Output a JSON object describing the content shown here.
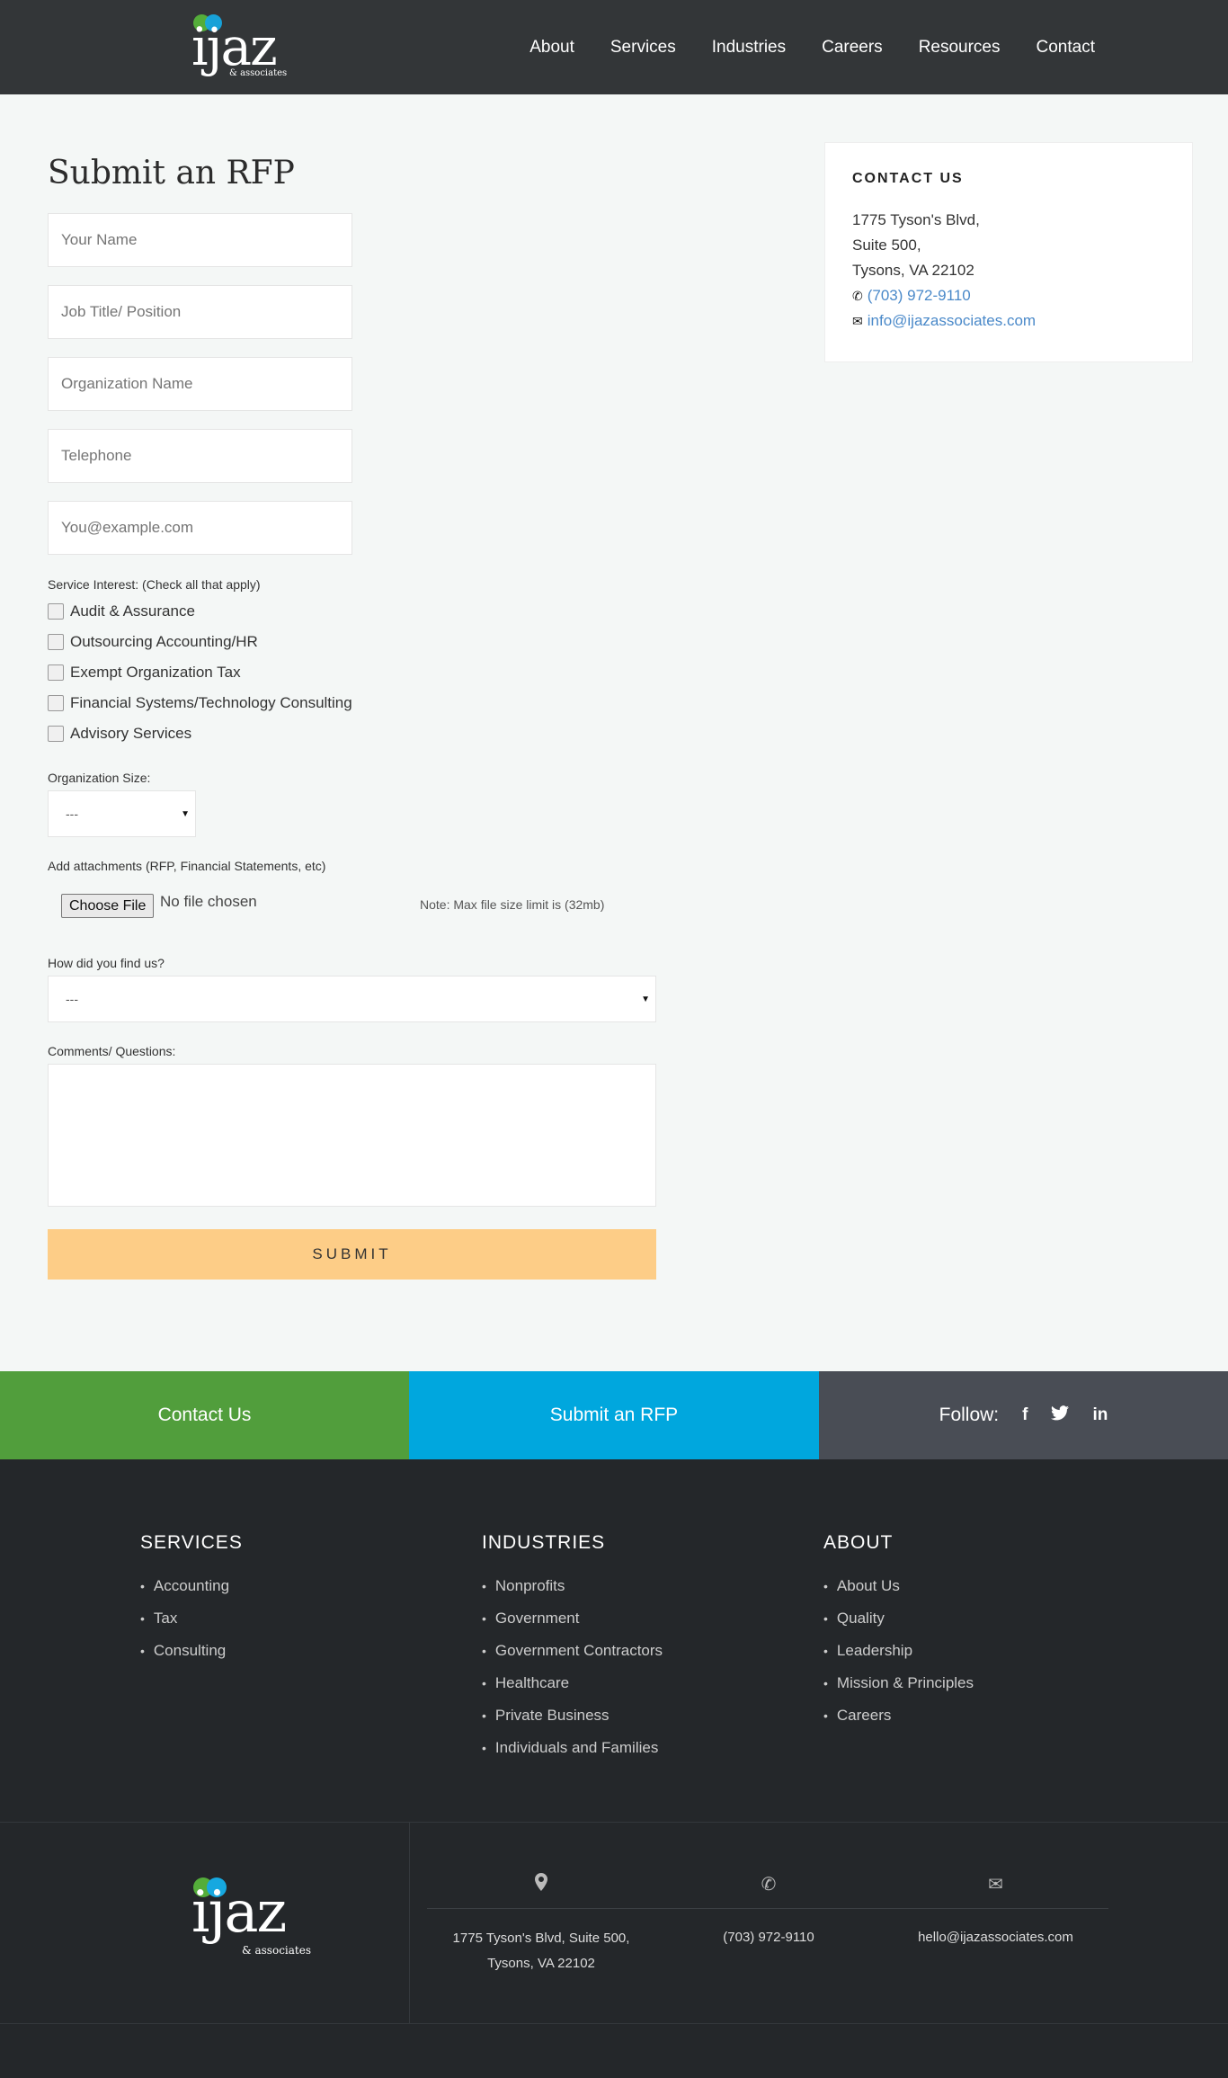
{
  "brand": {
    "logo_word": "ijaz",
    "logo_sub": "& associates"
  },
  "nav": [
    "About",
    "Services",
    "Industries",
    "Careers",
    "Resources",
    "Contact"
  ],
  "form": {
    "title": "Submit an RFP",
    "placeholders": {
      "name": "Your Name",
      "job": "Job Title/ Position",
      "org": "Organization Name",
      "phone": "Telephone",
      "email": "You@example.com"
    },
    "service_label": "Service Interest: (Check all that apply)",
    "services": [
      "Audit & Assurance",
      "Outsourcing Accounting/HR",
      "Exempt Organization Tax",
      "Financial Systems/Technology Consulting",
      "Advisory Services"
    ],
    "org_size_label": "Organization Size:",
    "org_size_value": "---",
    "attach_label": "Add attachments (RFP, Financial Statements, etc)",
    "file_button": "Choose File",
    "file_status": "No file chosen",
    "file_note": "Note: Max file size limit is (32mb)",
    "found_label": "How did you find us?",
    "found_value": "---",
    "comments_label": "Comments/ Questions:",
    "submit_label": "SUBMIT"
  },
  "contact_card": {
    "title": "CONTACT US",
    "address": [
      "1775 Tyson's Blvd,",
      "Suite 500,",
      "Tysons, VA 22102"
    ],
    "phone": "(703) 972-9110",
    "email": "info@ijazassociates.com",
    "icons": {
      "phone": "phone-icon",
      "email": "envelope-icon"
    }
  },
  "cta": {
    "contact": "Contact Us",
    "rfp": "Submit an RFP",
    "follow": "Follow:",
    "social": [
      "f",
      "t",
      "in"
    ],
    "colors": {
      "green": "#519e3c",
      "blue": "#00a7de",
      "grey": "#494d55"
    }
  },
  "footer": {
    "services": {
      "title": "SERVICES",
      "items": [
        "Accounting",
        "Tax",
        "Consulting"
      ]
    },
    "industries": {
      "title": "INDUSTRIES",
      "items": [
        "Nonprofits",
        "Government",
        "Government Contractors",
        "Healthcare",
        "Private Business",
        "Individuals and Families"
      ]
    },
    "about": {
      "title": "ABOUT",
      "items": [
        "About Us",
        "Quality",
        "Leadership",
        "Mission & Principles",
        "Careers"
      ]
    },
    "address_line1": "1775 Tyson's Blvd, Suite 500,",
    "address_line2": "Tysons, VA 22102",
    "phone": "(703) 972-9110",
    "email": "hello@ijazassociates.com"
  },
  "colors": {
    "header_bg": "#333638",
    "submit_bg": "#fdcd87",
    "footer_bg": "#24272a",
    "link": "#4a89c9"
  }
}
